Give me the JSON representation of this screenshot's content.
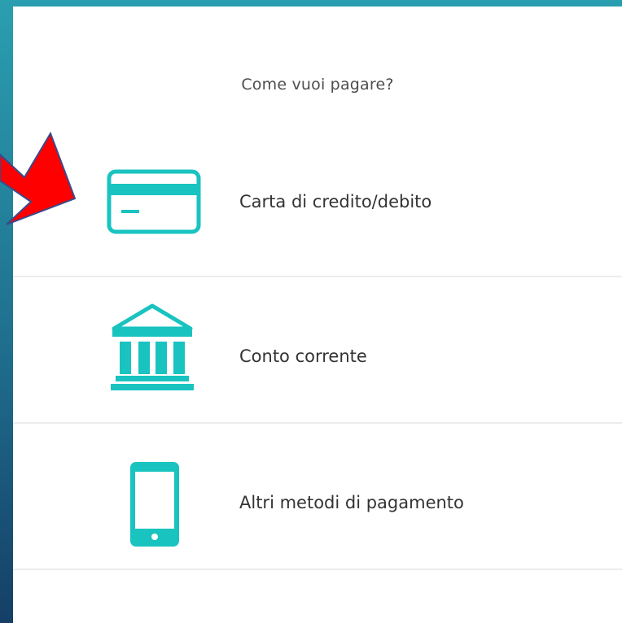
{
  "prompt": "Come vuoi pagare?",
  "options": [
    {
      "label": "Carta di credito/debito",
      "icon": "credit-card-icon"
    },
    {
      "label": "Conto corrente",
      "icon": "bank-icon"
    },
    {
      "label": "Altri metodi di pagamento",
      "icon": "smartphone-icon"
    }
  ],
  "colors": {
    "accent": "#19c3c0",
    "arrow": "#ff0000",
    "frame": "#1f7a95"
  }
}
